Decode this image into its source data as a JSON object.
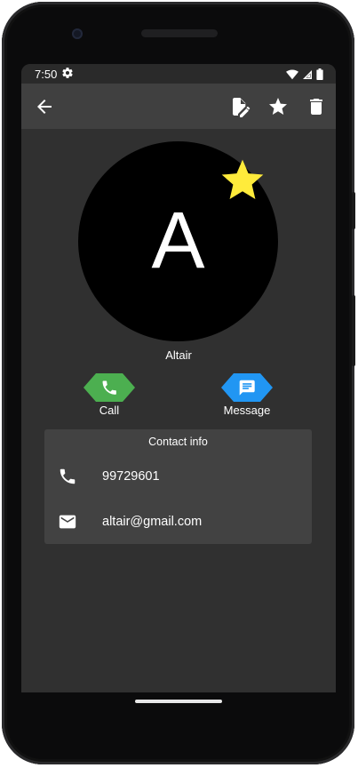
{
  "status_bar": {
    "time": "7:50",
    "icons": [
      "gear-icon",
      "wifi-icon",
      "signal-icon",
      "battery-icon"
    ]
  },
  "app_bar": {
    "back_icon": "arrow-back-icon",
    "actions": [
      "edit-icon",
      "star-icon",
      "delete-icon"
    ]
  },
  "contact": {
    "avatar_letter": "A",
    "avatar_color": "#000000",
    "favorite_color": "#ffeb3b",
    "name": "Altair"
  },
  "actions": {
    "call": {
      "label": "Call",
      "icon": "phone-icon",
      "color": "#4caf50"
    },
    "message": {
      "label": "Message",
      "icon": "message-icon",
      "color": "#2196f3"
    }
  },
  "contact_info": {
    "title": "Contact info",
    "phone": {
      "icon": "phone-icon",
      "value": "99729601"
    },
    "email": {
      "icon": "email-icon",
      "value": "altair@gmail.com"
    }
  }
}
